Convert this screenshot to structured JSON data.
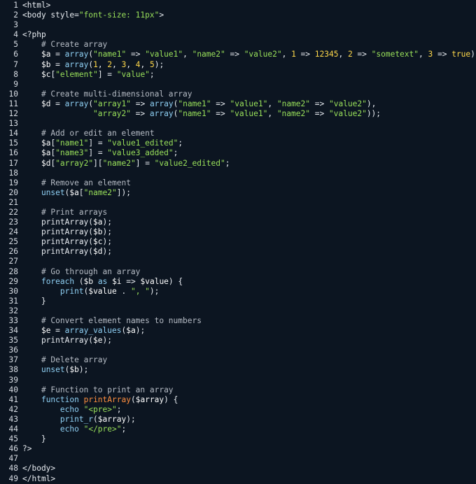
{
  "editor": {
    "lines": [
      {
        "n": "1",
        "t": [
          [
            "plain",
            "<html>"
          ]
        ]
      },
      {
        "n": "2",
        "t": [
          [
            "plain",
            "<body style="
          ],
          [
            "str",
            "\"font-size: 11px\""
          ],
          [
            "plain",
            ">"
          ]
        ]
      },
      {
        "n": "3",
        "t": []
      },
      {
        "n": "4",
        "t": [
          [
            "plain",
            "<?php"
          ]
        ]
      },
      {
        "n": "5",
        "t": [
          [
            "plain",
            "    "
          ],
          [
            "comment",
            "# Create array"
          ]
        ]
      },
      {
        "n": "6",
        "t": [
          [
            "plain",
            "    "
          ],
          [
            "var",
            "$a"
          ],
          [
            "plain",
            " = "
          ],
          [
            "kw",
            "array"
          ],
          [
            "plain",
            "("
          ],
          [
            "str",
            "\"name1\""
          ],
          [
            "plain",
            " => "
          ],
          [
            "str",
            "\"value1\""
          ],
          [
            "plain",
            ", "
          ],
          [
            "str",
            "\"name2\""
          ],
          [
            "plain",
            " => "
          ],
          [
            "str",
            "\"value2\""
          ],
          [
            "plain",
            ", "
          ],
          [
            "num",
            "1"
          ],
          [
            "plain",
            " => "
          ],
          [
            "num",
            "12345"
          ],
          [
            "plain",
            ", "
          ],
          [
            "num",
            "2"
          ],
          [
            "plain",
            " => "
          ],
          [
            "str",
            "\"sometext\""
          ],
          [
            "plain",
            ", "
          ],
          [
            "num",
            "3"
          ],
          [
            "plain",
            " => "
          ],
          [
            "num",
            "true"
          ],
          [
            "plain",
            ");"
          ]
        ]
      },
      {
        "n": "7",
        "t": [
          [
            "plain",
            "    "
          ],
          [
            "var",
            "$b"
          ],
          [
            "plain",
            " = "
          ],
          [
            "kw",
            "array"
          ],
          [
            "plain",
            "("
          ],
          [
            "num",
            "1"
          ],
          [
            "plain",
            ", "
          ],
          [
            "num",
            "2"
          ],
          [
            "plain",
            ", "
          ],
          [
            "num",
            "3"
          ],
          [
            "plain",
            ", "
          ],
          [
            "num",
            "4"
          ],
          [
            "plain",
            ", "
          ],
          [
            "num",
            "5"
          ],
          [
            "plain",
            ");"
          ]
        ]
      },
      {
        "n": "8",
        "t": [
          [
            "plain",
            "    "
          ],
          [
            "var",
            "$c"
          ],
          [
            "plain",
            "["
          ],
          [
            "str",
            "\"element\""
          ],
          [
            "plain",
            "] = "
          ],
          [
            "str",
            "\"value\""
          ],
          [
            "plain",
            ";"
          ]
        ]
      },
      {
        "n": "9",
        "t": []
      },
      {
        "n": "10",
        "t": [
          [
            "plain",
            "    "
          ],
          [
            "comment",
            "# Create multi-dimensional array"
          ]
        ]
      },
      {
        "n": "11",
        "t": [
          [
            "plain",
            "    "
          ],
          [
            "var",
            "$d"
          ],
          [
            "plain",
            " = "
          ],
          [
            "kw",
            "array"
          ],
          [
            "plain",
            "("
          ],
          [
            "str",
            "\"array1\""
          ],
          [
            "plain",
            " => "
          ],
          [
            "kw",
            "array"
          ],
          [
            "plain",
            "("
          ],
          [
            "str",
            "\"name1\""
          ],
          [
            "plain",
            " => "
          ],
          [
            "str",
            "\"value1\""
          ],
          [
            "plain",
            ", "
          ],
          [
            "str",
            "\"name2\""
          ],
          [
            "plain",
            " => "
          ],
          [
            "str",
            "\"value2\""
          ],
          [
            "plain",
            "),"
          ]
        ]
      },
      {
        "n": "12",
        "t": [
          [
            "plain",
            "               "
          ],
          [
            "str",
            "\"array2\""
          ],
          [
            "plain",
            " => "
          ],
          [
            "kw",
            "array"
          ],
          [
            "plain",
            "("
          ],
          [
            "str",
            "\"name1\""
          ],
          [
            "plain",
            " => "
          ],
          [
            "str",
            "\"value1\""
          ],
          [
            "plain",
            ", "
          ],
          [
            "str",
            "\"name2\""
          ],
          [
            "plain",
            " => "
          ],
          [
            "str",
            "\"value2\""
          ],
          [
            "plain",
            "));"
          ]
        ]
      },
      {
        "n": "13",
        "t": []
      },
      {
        "n": "14",
        "t": [
          [
            "plain",
            "    "
          ],
          [
            "comment",
            "# Add or edit an element"
          ]
        ]
      },
      {
        "n": "15",
        "t": [
          [
            "plain",
            "    "
          ],
          [
            "var",
            "$a"
          ],
          [
            "plain",
            "["
          ],
          [
            "str",
            "\"name1\""
          ],
          [
            "plain",
            "] = "
          ],
          [
            "str",
            "\"value1_edited\""
          ],
          [
            "plain",
            ";"
          ]
        ]
      },
      {
        "n": "16",
        "t": [
          [
            "plain",
            "    "
          ],
          [
            "var",
            "$a"
          ],
          [
            "plain",
            "["
          ],
          [
            "str",
            "\"name3\""
          ],
          [
            "plain",
            "] = "
          ],
          [
            "str",
            "\"value3_added\""
          ],
          [
            "plain",
            ";"
          ]
        ]
      },
      {
        "n": "17",
        "t": [
          [
            "plain",
            "    "
          ],
          [
            "var",
            "$d"
          ],
          [
            "plain",
            "["
          ],
          [
            "str",
            "\"array2\""
          ],
          [
            "plain",
            "]["
          ],
          [
            "str",
            "\"name2\""
          ],
          [
            "plain",
            "] = "
          ],
          [
            "str",
            "\"value2_edited\""
          ],
          [
            "plain",
            ";"
          ]
        ]
      },
      {
        "n": "18",
        "t": []
      },
      {
        "n": "19",
        "t": [
          [
            "plain",
            "    "
          ],
          [
            "comment",
            "# Remove an element"
          ]
        ]
      },
      {
        "n": "20",
        "t": [
          [
            "plain",
            "    "
          ],
          [
            "kw",
            "unset"
          ],
          [
            "plain",
            "("
          ],
          [
            "var",
            "$a"
          ],
          [
            "plain",
            "["
          ],
          [
            "str",
            "\"name2\""
          ],
          [
            "plain",
            "]);"
          ]
        ]
      },
      {
        "n": "21",
        "t": []
      },
      {
        "n": "22",
        "t": [
          [
            "plain",
            "    "
          ],
          [
            "comment",
            "# Print arrays"
          ]
        ]
      },
      {
        "n": "23",
        "t": [
          [
            "plain",
            "    printArray("
          ],
          [
            "var",
            "$a"
          ],
          [
            "plain",
            ");"
          ]
        ]
      },
      {
        "n": "24",
        "t": [
          [
            "plain",
            "    printArray("
          ],
          [
            "var",
            "$b"
          ],
          [
            "plain",
            ");"
          ]
        ]
      },
      {
        "n": "25",
        "t": [
          [
            "plain",
            "    printArray("
          ],
          [
            "var",
            "$c"
          ],
          [
            "plain",
            ");"
          ]
        ]
      },
      {
        "n": "26",
        "t": [
          [
            "plain",
            "    printArray("
          ],
          [
            "var",
            "$d"
          ],
          [
            "plain",
            ");"
          ]
        ]
      },
      {
        "n": "27",
        "t": []
      },
      {
        "n": "28",
        "t": [
          [
            "plain",
            "    "
          ],
          [
            "comment",
            "# Go through an array"
          ]
        ]
      },
      {
        "n": "29",
        "t": [
          [
            "plain",
            "    "
          ],
          [
            "kw",
            "foreach"
          ],
          [
            "plain",
            " ("
          ],
          [
            "var",
            "$b"
          ],
          [
            "plain",
            " "
          ],
          [
            "kw",
            "as"
          ],
          [
            "plain",
            " "
          ],
          [
            "var",
            "$i"
          ],
          [
            "plain",
            " => "
          ],
          [
            "var",
            "$value"
          ],
          [
            "plain",
            ") {"
          ]
        ]
      },
      {
        "n": "30",
        "t": [
          [
            "plain",
            "        "
          ],
          [
            "kw",
            "print"
          ],
          [
            "plain",
            "("
          ],
          [
            "var",
            "$value"
          ],
          [
            "plain",
            " . "
          ],
          [
            "str",
            "\", \""
          ],
          [
            "plain",
            ");"
          ]
        ]
      },
      {
        "n": "31",
        "t": [
          [
            "plain",
            "    }"
          ]
        ]
      },
      {
        "n": "32",
        "t": []
      },
      {
        "n": "33",
        "t": [
          [
            "plain",
            "    "
          ],
          [
            "comment",
            "# Convert element names to numbers"
          ]
        ]
      },
      {
        "n": "34",
        "t": [
          [
            "plain",
            "    "
          ],
          [
            "var",
            "$e"
          ],
          [
            "plain",
            " = "
          ],
          [
            "kw",
            "array_values"
          ],
          [
            "plain",
            "("
          ],
          [
            "var",
            "$a"
          ],
          [
            "plain",
            ");"
          ]
        ]
      },
      {
        "n": "35",
        "t": [
          [
            "plain",
            "    printArray("
          ],
          [
            "var",
            "$e"
          ],
          [
            "plain",
            ");"
          ]
        ]
      },
      {
        "n": "36",
        "t": []
      },
      {
        "n": "37",
        "t": [
          [
            "plain",
            "    "
          ],
          [
            "comment",
            "# Delete array"
          ]
        ]
      },
      {
        "n": "38",
        "t": [
          [
            "plain",
            "    "
          ],
          [
            "kw",
            "unset"
          ],
          [
            "plain",
            "("
          ],
          [
            "var",
            "$b"
          ],
          [
            "plain",
            ");"
          ]
        ]
      },
      {
        "n": "39",
        "t": []
      },
      {
        "n": "40",
        "t": [
          [
            "plain",
            "    "
          ],
          [
            "comment",
            "# Function to print an array"
          ]
        ]
      },
      {
        "n": "41",
        "t": [
          [
            "plain",
            "    "
          ],
          [
            "kw",
            "function"
          ],
          [
            "plain",
            " "
          ],
          [
            "fn",
            "printArray"
          ],
          [
            "plain",
            "("
          ],
          [
            "var",
            "$array"
          ],
          [
            "plain",
            ") {"
          ]
        ]
      },
      {
        "n": "42",
        "t": [
          [
            "plain",
            "        "
          ],
          [
            "kw",
            "echo"
          ],
          [
            "plain",
            " "
          ],
          [
            "str",
            "\"<pre>\""
          ],
          [
            "plain",
            ";"
          ]
        ]
      },
      {
        "n": "43",
        "t": [
          [
            "plain",
            "        "
          ],
          [
            "kw",
            "print_r"
          ],
          [
            "plain",
            "("
          ],
          [
            "var",
            "$array"
          ],
          [
            "plain",
            ");"
          ]
        ]
      },
      {
        "n": "44",
        "t": [
          [
            "plain",
            "        "
          ],
          [
            "kw",
            "echo"
          ],
          [
            "plain",
            " "
          ],
          [
            "str",
            "\"</pre>\""
          ],
          [
            "plain",
            ";"
          ]
        ]
      },
      {
        "n": "45",
        "t": [
          [
            "plain",
            "    }"
          ]
        ]
      },
      {
        "n": "46",
        "t": [
          [
            "plain",
            "?>"
          ]
        ]
      },
      {
        "n": "47",
        "t": []
      },
      {
        "n": "48",
        "t": [
          [
            "plain",
            "</body>"
          ]
        ]
      },
      {
        "n": "49",
        "t": [
          [
            "plain",
            "</html>"
          ]
        ]
      }
    ]
  }
}
